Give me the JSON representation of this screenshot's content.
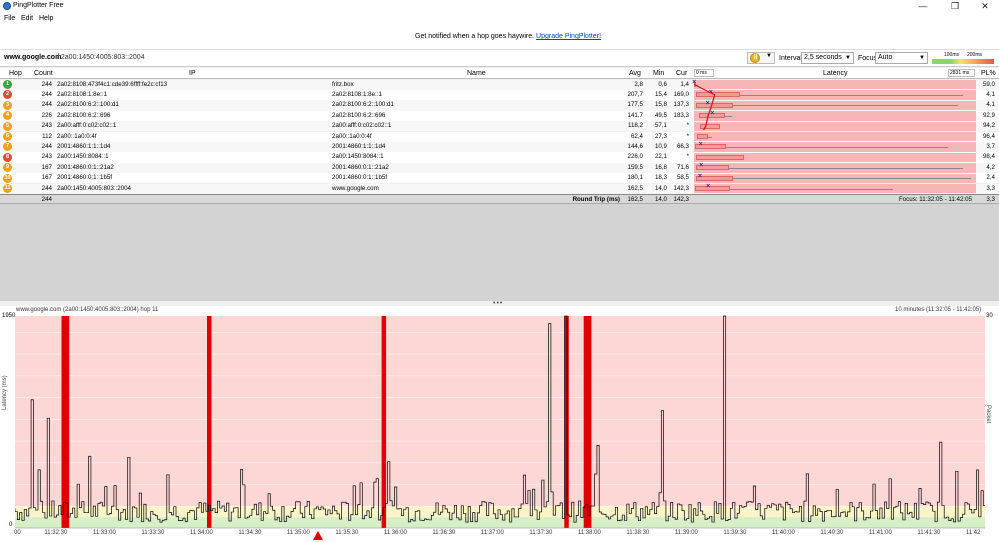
{
  "window": {
    "title": "PingPlotter Free",
    "minimize": "—",
    "maximize": "❒",
    "close": "✕"
  },
  "menu": [
    "File",
    "Edit",
    "Help"
  ],
  "banner": {
    "text": "Get notified when a hop goes haywire.",
    "link": "Upgrade PingPlotter!"
  },
  "toolbar": {
    "host": "www.google.com",
    "address": "/ 2a00:1450:4005:803::2004",
    "interval_label": "Interval",
    "interval_value": "2,5 seconds",
    "focus_label": "Focus",
    "focus_value": "Auto",
    "scale_100": "100ms",
    "scale_200": "200ms",
    "pause_icon": "pause-icon"
  },
  "table": {
    "headers": {
      "hop": "Hop",
      "count": "Count",
      "ip": "IP",
      "name": "Name",
      "avg": "Avg",
      "min": "Min",
      "cur": "Cur",
      "latency": "Latency",
      "pl": "PL%",
      "lat_min": "0 ms",
      "lat_max": "2831 ms"
    },
    "rows": [
      {
        "hop": "1",
        "count": "244",
        "ip": "2a02:8108:473f4c1:cde39:6ffff:fe2c:cf13",
        "name": "fritz.box",
        "avg": "2,8",
        "min": "0,6",
        "cur": "1,4",
        "pl": "59,0",
        "color": "#3aa63a",
        "avg_v": 2.8,
        "min_v": 0.6,
        "max_v": 40,
        "cur_v": 1.4
      },
      {
        "hop": "2",
        "count": "244",
        "ip": "2a02:8108:1:8e::1",
        "name": "2a02:8108:1:8e::1",
        "avg": "207,7",
        "min": "15,4",
        "cur": "169,0",
        "pl": "4,1",
        "color": "#e8443a",
        "avg_v": 207.7,
        "min_v": 15.4,
        "max_v": 2700,
        "cur_v": 169.0
      },
      {
        "hop": "3",
        "count": "244",
        "ip": "2a02:8100:6:2::100:d1",
        "name": "2a02:8100:6:2::100:d1",
        "avg": "177,5",
        "min": "15,8",
        "cur": "137,3",
        "pl": "4,1",
        "color": "#f0a020",
        "avg_v": 177.5,
        "min_v": 15.8,
        "max_v": 2650,
        "cur_v": 137.3
      },
      {
        "hop": "4",
        "count": "226",
        "ip": "2a02:8100:6:2::696",
        "name": "2a02:8100:6:2::696",
        "avg": "141,7",
        "min": "49,5",
        "cur": "183,3",
        "pl": "92,9",
        "color": "#f0a020",
        "avg_v": 141.7,
        "min_v": 49.5,
        "max_v": 380,
        "cur_v": 183.3
      },
      {
        "hop": "5",
        "count": "243",
        "ip": "2a00:afff:0:c02:c02::1",
        "name": "2a00:afff:0:c02:c02::1",
        "avg": "118,2",
        "min": "57,1",
        "cur": "*",
        "pl": "94,2",
        "color": "#f0a020",
        "avg_v": 118.2,
        "min_v": 57.1,
        "max_v": 260,
        "cur_v": null
      },
      {
        "hop": "6",
        "count": "112",
        "ip": "2a00::1a0:0:4f",
        "name": "2a00::1a0:0:4f",
        "avg": "62,4",
        "min": "27,3",
        "cur": "*",
        "pl": "96,4",
        "color": "#f0a020",
        "avg_v": 62.4,
        "min_v": 27.3,
        "max_v": 180,
        "cur_v": null
      },
      {
        "hop": "7",
        "count": "244",
        "ip": "2001:4860:1:1::1d4",
        "name": "2001:4860:1:1::1d4",
        "avg": "144,6",
        "min": "10,9",
        "cur": "66,3",
        "pl": "3,7",
        "color": "#f0a020",
        "avg_v": 144.6,
        "min_v": 10.9,
        "max_v": 2550,
        "cur_v": 66.3
      },
      {
        "hop": "8",
        "count": "243",
        "ip": "2a00:1450:8084::1",
        "name": "2a00:1450:8084::1",
        "avg": "226,0",
        "min": "22,1",
        "cur": "*",
        "pl": "98,4",
        "color": "#e8443a",
        "avg_v": 226.0,
        "min_v": 22.1,
        "max_v": 480,
        "cur_v": null
      },
      {
        "hop": "9",
        "count": "167",
        "ip": "2001:4860:0:1::21a2",
        "name": "2001:4860:0:1::21a2",
        "avg": "159,5",
        "min": "16,8",
        "cur": "71,6",
        "pl": "4,2",
        "color": "#f0a020",
        "avg_v": 159.5,
        "min_v": 16.8,
        "max_v": 2700,
        "cur_v": 71.6
      },
      {
        "hop": "10",
        "count": "167",
        "ip": "2001:4860:0:1::1b5f",
        "name": "2001:4860:0:1::1b5f",
        "avg": "180,1",
        "min": "18,3",
        "cur": "58,5",
        "pl": "2,4",
        "color": "#f0a020",
        "avg_v": 180.1,
        "min_v": 18.3,
        "max_v": 2780,
        "cur_v": 58.5
      },
      {
        "hop": "11",
        "count": "244",
        "ip": "2a00:1450:4005:803::2004",
        "name": "www.google.com",
        "avg": "162,5",
        "min": "14,0",
        "cur": "142,3",
        "pl": "3,3",
        "color": "#f0a020",
        "avg_v": 162.5,
        "min_v": 14.0,
        "max_v": 2000,
        "cur_v": 142.3
      }
    ],
    "summary": {
      "count": "244",
      "label": "Round Trip (ms)",
      "avg": "162,5",
      "min": "14,0",
      "cur": "142,3",
      "focus": "Focus: 11:32:05 - 11:42:05",
      "pl": "3,3"
    }
  },
  "graph": {
    "title": "www.google.com (2a00:1450:4005:803::2004) hop 11",
    "range": "10 minutes (11:32:05 - 11:42:05)",
    "y_top": "1950",
    "y_bottom": "0",
    "y_label": "Latency (ms)",
    "y2_top": "30",
    "y2_label": "Packet Loss %",
    "x_ticks": [
      "11:32:30",
      "11:33:00",
      "11:33:30",
      "11:34:00",
      "11:34:30",
      "11:35:00",
      "11:35:30",
      "11:36:00",
      "11:36:30",
      "11:37:00",
      "11:37:30",
      "11:38:00",
      "11:38:30",
      "11:39:00",
      "11:39:30",
      "11:40:00",
      "11:40:30",
      "11:41:00",
      "11:41:30",
      "11:42"
    ],
    "first_tick": "00",
    "colors": {
      "good": "#d6efc7",
      "warn": "#fbf4c8",
      "bad": "#fdd6d6",
      "loss": "#e00000",
      "line": "#000000"
    }
  },
  "chart_data": {
    "type": "line",
    "title": "www.google.com (2a00:1450:4005:803::2004) hop 11",
    "ylabel": "Latency (ms)",
    "ylim": [
      0,
      1950
    ],
    "x_range": [
      "11:32:05",
      "11:42:05"
    ],
    "loss_events_times": [
      "11:32:35",
      "11:32:37",
      "11:34:05",
      "11:35:53",
      "11:37:46",
      "11:37:58",
      "11:38:00"
    ],
    "latency_spikes": [
      {
        "t": "11:32:15",
        "ms": 1180
      },
      {
        "t": "11:32:25",
        "ms": 1010
      },
      {
        "t": "11:32:50",
        "ms": 660
      },
      {
        "t": "11:33:15",
        "ms": 650
      },
      {
        "t": "11:35:55",
        "ms": 610
      },
      {
        "t": "11:37:35",
        "ms": 1880
      },
      {
        "t": "11:37:45",
        "ms": 1960
      },
      {
        "t": "11:38:05",
        "ms": 760
      },
      {
        "t": "11:38:45",
        "ms": 1080
      },
      {
        "t": "11:39:23",
        "ms": 1960
      },
      {
        "t": "11:41:37",
        "ms": 790
      }
    ],
    "baseline_ms": 180
  }
}
